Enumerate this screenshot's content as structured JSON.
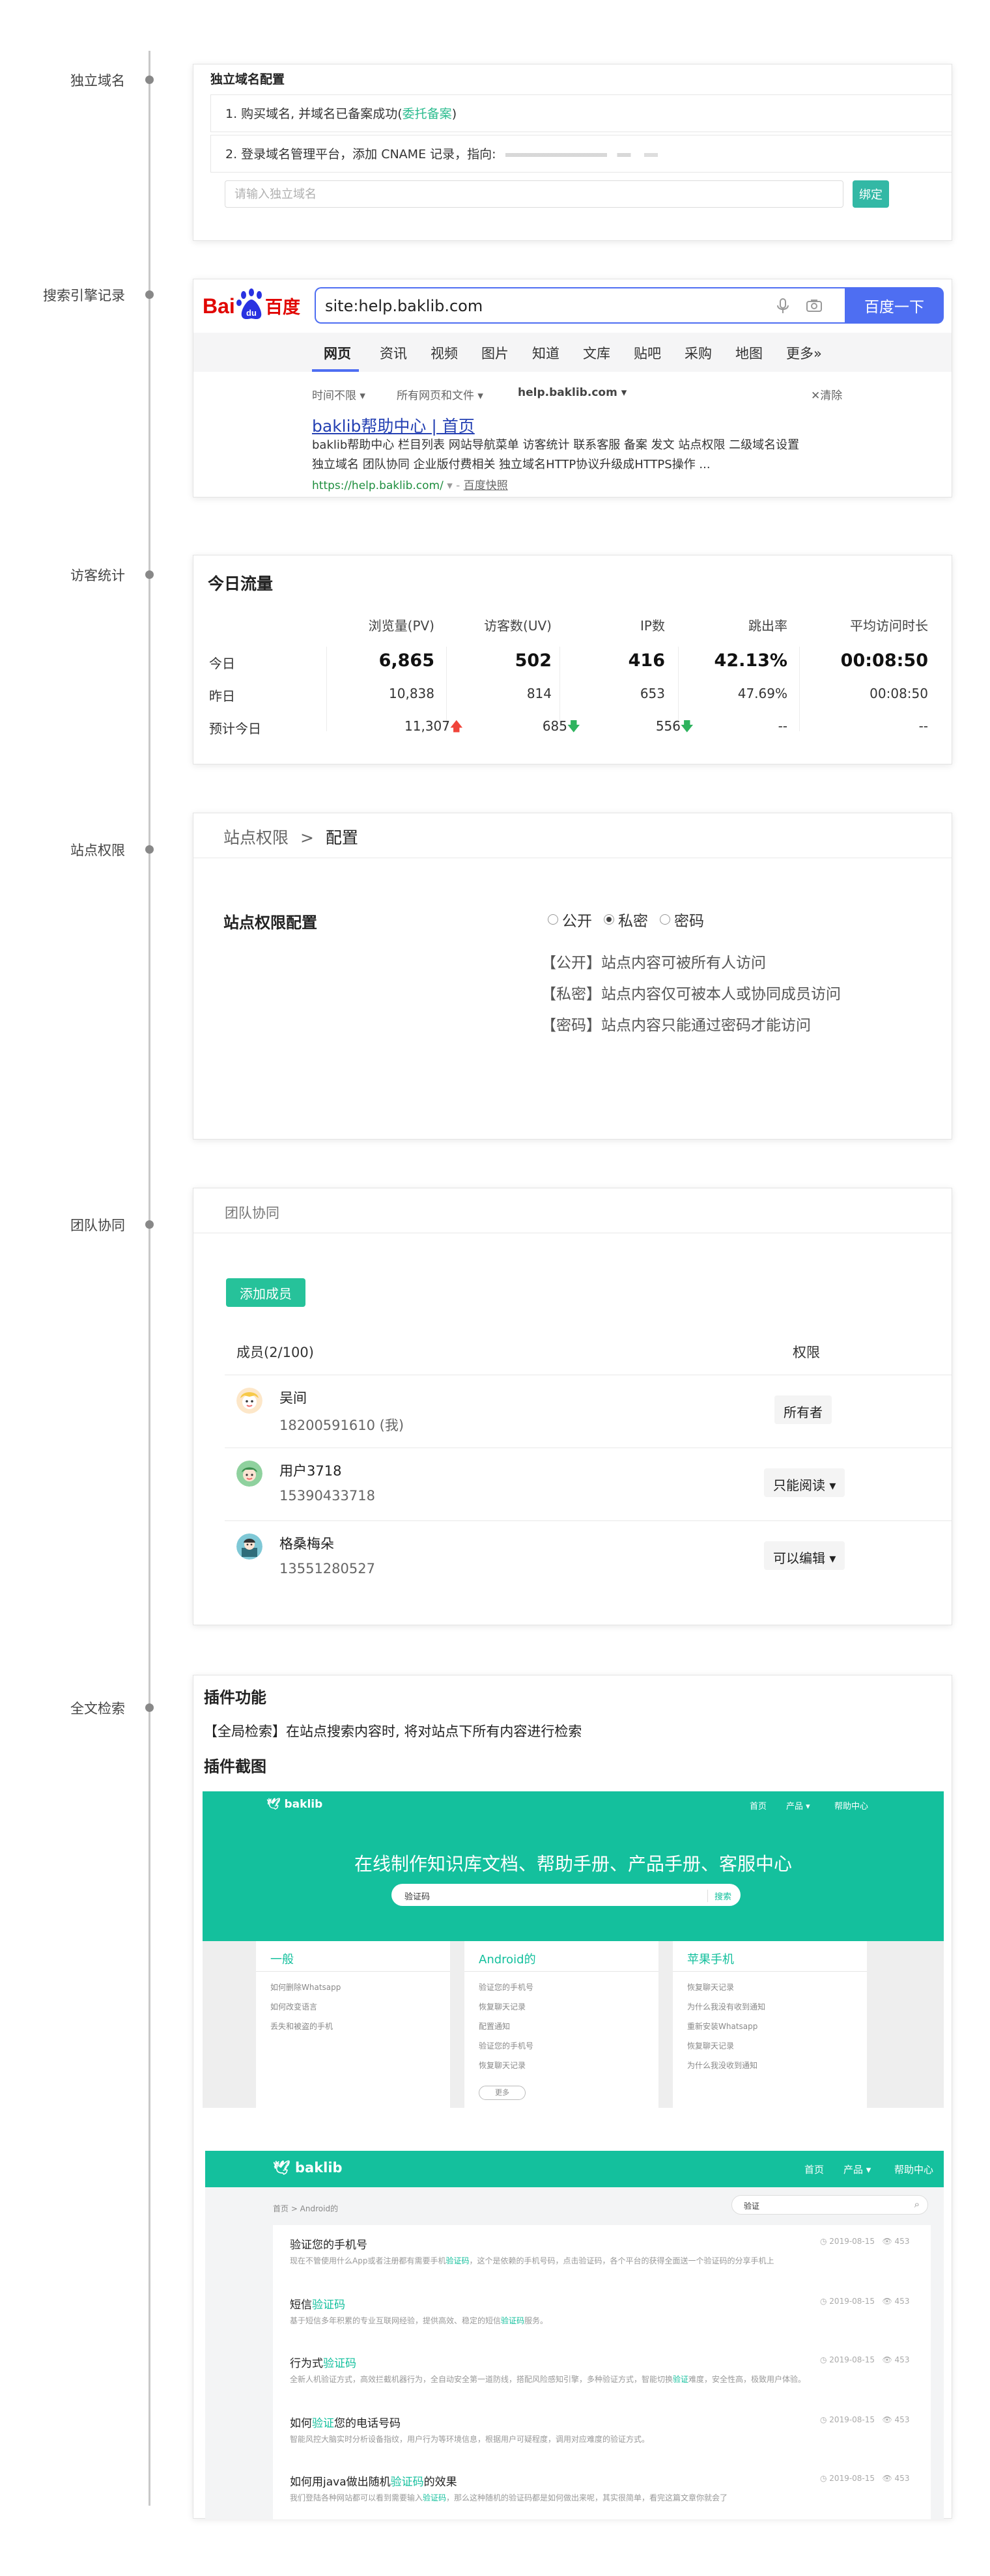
{
  "timeline": {
    "sections": [
      {
        "label": "独立域名"
      },
      {
        "label": "搜索引擎记录"
      },
      {
        "label": "访客统计"
      },
      {
        "label": "站点权限"
      },
      {
        "label": "团队协同"
      },
      {
        "label": "全文检索"
      }
    ]
  },
  "domain": {
    "title": "独立域名配置",
    "step1_prefix": "1. 购买域名, 并域名已备案成功(",
    "step1_link": "委托备案",
    "step1_suffix": ")",
    "step2": "2. 登录域名管理平台，添加 CNAME 记录，指向: ",
    "input_placeholder": "请输入独立域名",
    "bind_label": "绑定"
  },
  "baidu": {
    "logo_text": "Bai百度",
    "query": "site:help.baklib.com",
    "search_btn": "百度一下",
    "tabs": [
      "网页",
      "资讯",
      "视频",
      "图片",
      "知道",
      "文库",
      "贴吧",
      "采购",
      "地图",
      "更多»"
    ],
    "filters": [
      "时间不限",
      "所有网页和文件",
      "help.baklib.com"
    ],
    "clear": "清除",
    "result_title": "baklib帮助中心 | 首页",
    "result_desc1": "baklib帮助中心 栏目列表 网站导航菜单 访客统计 联系客服 备案 发文 站点权限 二级域名设置",
    "result_desc2": "独立域名 团队协同 企业版付费相关 独立域名HTTP协议升级成HTTPS操作 ...",
    "result_url": "https://help.baklib.com/",
    "result_snapshot": "百度快照",
    "colors": {
      "blue": "#4e6ef2",
      "red": "#e10602"
    }
  },
  "stats": {
    "title": "今日流量",
    "headers": [
      "浏览量(PV)",
      "访客数(UV)",
      "IP数",
      "跳出率",
      "平均访问时长"
    ],
    "rows": [
      {
        "label": "今日",
        "values": [
          "6,865",
          "502",
          "416",
          "42.13%",
          "00:08:50"
        ]
      },
      {
        "label": "昨日",
        "values": [
          "10,838",
          "814",
          "653",
          "47.69%",
          "00:08:50"
        ]
      },
      {
        "label": "预计今日",
        "values": [
          "11,307",
          "685",
          "556",
          "--",
          "--"
        ]
      }
    ]
  },
  "perm": {
    "breadcrumb_parent": "站点权限",
    "breadcrumb_sep": ">",
    "breadcrumb_current": "配置",
    "label": "站点权限配置",
    "options": [
      "公开",
      "私密",
      "密码"
    ],
    "selected": "私密",
    "descs": [
      "【公开】站点内容可被所有人访问",
      "【私密】站点内容仅可被本人或协同成员访问",
      "【密码】站点内容只能通过密码才能访问"
    ]
  },
  "team": {
    "header": "团队协同",
    "add_btn": "添加成员",
    "col_members": "成员(2/100)",
    "col_perm": "权限",
    "members": [
      {
        "name": "吴间",
        "phone": "18200591610 (我)",
        "perm": "所有者"
      },
      {
        "name": "用户3718",
        "phone": "15390433718",
        "perm": "只能阅读 ▾"
      },
      {
        "name": "格桑梅朵",
        "phone": "13551280527",
        "perm": "可以编辑 ▾"
      }
    ]
  },
  "plugin": {
    "title": "插件功能",
    "desc": "【全局检索】在站点搜索内容时, 将对站点下所有内容进行检索",
    "shot_title": "插件截图",
    "shot1": {
      "logo": "baklib",
      "nav": [
        "首页",
        "产品 ▾",
        "帮助中心"
      ],
      "headline": "在线制作知识库文档、帮助手册、产品手册、客服中心",
      "search_value": "验证码",
      "search_btn": "搜索",
      "columns": [
        {
          "title": "一般",
          "items": [
            "如何删除Whatsapp",
            "如何改变语言",
            "丢失和被盗的手机"
          ]
        },
        {
          "title": "Android的",
          "items": [
            "验证您的手机号",
            "恢复聊天记录",
            "配置通知",
            "验证您的手机号",
            "恢复聊天记录"
          ],
          "more": "更多"
        },
        {
          "title": "苹果手机",
          "items": [
            "恢复聊天记录",
            "为什么我没有收到通知",
            "重新安装Whatsapp",
            "恢复聊天记录",
            "为什么我没收到通知"
          ]
        }
      ]
    },
    "shot2": {
      "logo": "baklib",
      "nav": [
        "首页",
        "产品 ▾",
        "帮助中心"
      ],
      "breadcrumb": "首页 > Android的",
      "search_value": "验证",
      "results": [
        {
          "t1": "验证您的手机号",
          "th": "",
          "t2": "",
          "d1": "现在不管使用什么App或者注册都有需要手机",
          "dh": "验证码",
          "d2": "，这个是依赖的手机号码，点击验证码，各个平台的获得全面送一个验证码的分享手机上",
          "date": "2019-08-15",
          "views": "453"
        },
        {
          "t1": "短信",
          "th": "验证码",
          "t2": "",
          "d1": "基于短信多年积累的专业互联网经验，提供高效、稳定的短信",
          "dh": "验证码",
          "d2": "服务。",
          "date": "2019-08-15",
          "views": "453"
        },
        {
          "t1": "行为式",
          "th": "验证码",
          "t2": "",
          "d1": "全新人机验证方式，高效拦截机器行为，全自动安全第一道防线，搭配风险感知引擎，多种验证方式，智能切换",
          "dh": "验证",
          "d2": "难度，安全性高，极致用户体验。",
          "date": "2019-08-15",
          "views": "453"
        },
        {
          "t1": "如何",
          "th": "验证",
          "t2": "您的电话号码",
          "d1": "智能风控大脑实时分析设备指纹，用户行为等环境信息，根据用户可疑程度，调用对应难度的验证方式。",
          "dh": "",
          "d2": "",
          "date": "2019-08-15",
          "views": "453"
        },
        {
          "t1": "如何用java做出随机",
          "th": "验证码",
          "t2": "的效果",
          "d1": "我们登陆各种网站都可以看到需要输入",
          "dh": "验证码",
          "d2": "，那么这种随机的验证码都是如何做出来呢，其实很简单，看完这篇文章你就会了",
          "date": "2019-08-15",
          "views": "453"
        }
      ]
    }
  }
}
